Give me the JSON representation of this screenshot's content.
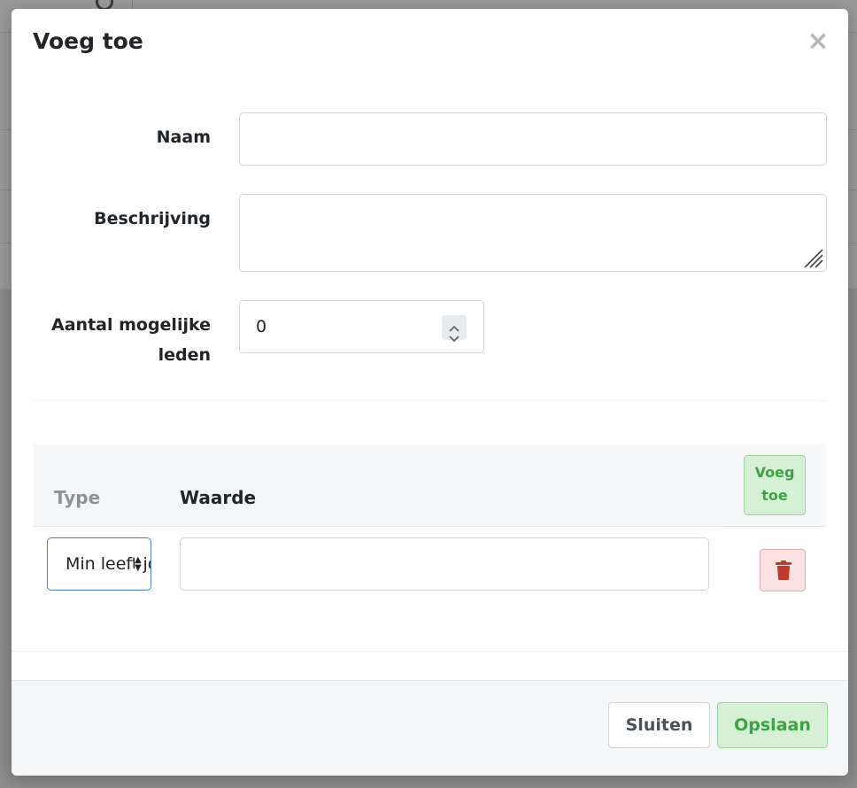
{
  "modal": {
    "title": "Voeg toe"
  },
  "form": {
    "name_label": "Naam",
    "name_value": "",
    "description_label": "Beschrijving",
    "description_value": "",
    "members_label_line1": "Aantal mogelijke",
    "members_label_line2": "leden",
    "members_value": "0"
  },
  "conditions_table": {
    "headers": {
      "type": "Type",
      "value": "Waarde",
      "add_button_line1": "Voeg",
      "add_button_line2": "toe"
    },
    "rows": [
      {
        "type": "Min leeftijd",
        "value": ""
      }
    ]
  },
  "footer": {
    "close_label": "Sluiten",
    "save_label": "Opslaan"
  },
  "icons": {
    "close": "close-icon",
    "trash": "trash-icon",
    "spinner": "spinner-icon",
    "select_caret": "chevron-updown-icon"
  },
  "colors": {
    "success_text": "#3ea344",
    "success_bg": "#d6f0d6",
    "danger_text": "#c0392b",
    "danger_bg": "#fbe3e3",
    "focus_border": "#4a7fd0"
  }
}
